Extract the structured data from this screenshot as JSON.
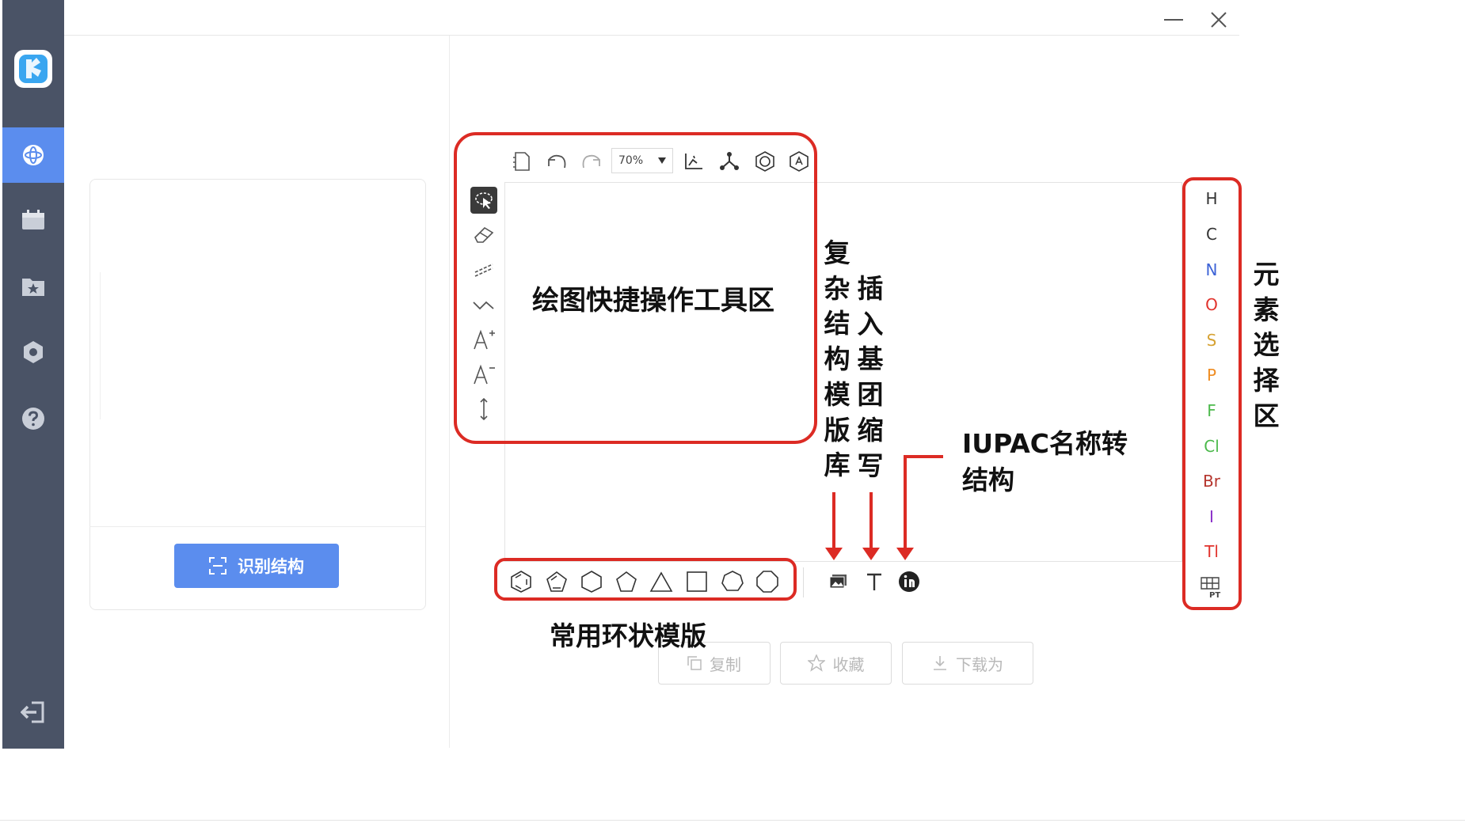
{
  "sidebar": {
    "nav": [
      {
        "icon": "atom-icon",
        "active": true
      },
      {
        "icon": "calendar-icon"
      },
      {
        "icon": "folder-star-icon"
      },
      {
        "icon": "hexagon-gear-icon"
      },
      {
        "icon": "help-icon"
      }
    ],
    "logout_icon": "logout-icon"
  },
  "left_panel": {
    "recognize_label": "识别结构"
  },
  "toolbar": {
    "zoom_value": "70%"
  },
  "elements": [
    {
      "symbol": "H",
      "color": "#333333"
    },
    {
      "symbol": "C",
      "color": "#333333"
    },
    {
      "symbol": "N",
      "color": "#3d63d6"
    },
    {
      "symbol": "O",
      "color": "#e1322c"
    },
    {
      "symbol": "S",
      "color": "#d6a233"
    },
    {
      "symbol": "P",
      "color": "#ef8d23"
    },
    {
      "symbol": "F",
      "color": "#4cb94c"
    },
    {
      "symbol": "Cl",
      "color": "#4cb94c"
    },
    {
      "symbol": "Br",
      "color": "#b5352d"
    },
    {
      "symbol": "I",
      "color": "#8a2fc9"
    },
    {
      "symbol": "Tl",
      "color": "#e1322c"
    }
  ],
  "periodic_table_label": "PT",
  "actions": {
    "copy_label": "复制",
    "favorite_label": "收藏",
    "download_label": "下载为"
  },
  "annotations": {
    "drawing_tools": "绘图快捷操作工具区",
    "complex_templates": "复杂结构模版库",
    "insert_abbrev": "插入基团缩写",
    "iupac_line1": "IUPAC名称转",
    "iupac_line2": "结构",
    "element_zone": "元素选择区",
    "ring_templates": "常用环状模版"
  },
  "colors": {
    "sidebar_bg": "#4a5366",
    "accent": "#5b8dee",
    "annotation_red": "#dc2b24"
  }
}
